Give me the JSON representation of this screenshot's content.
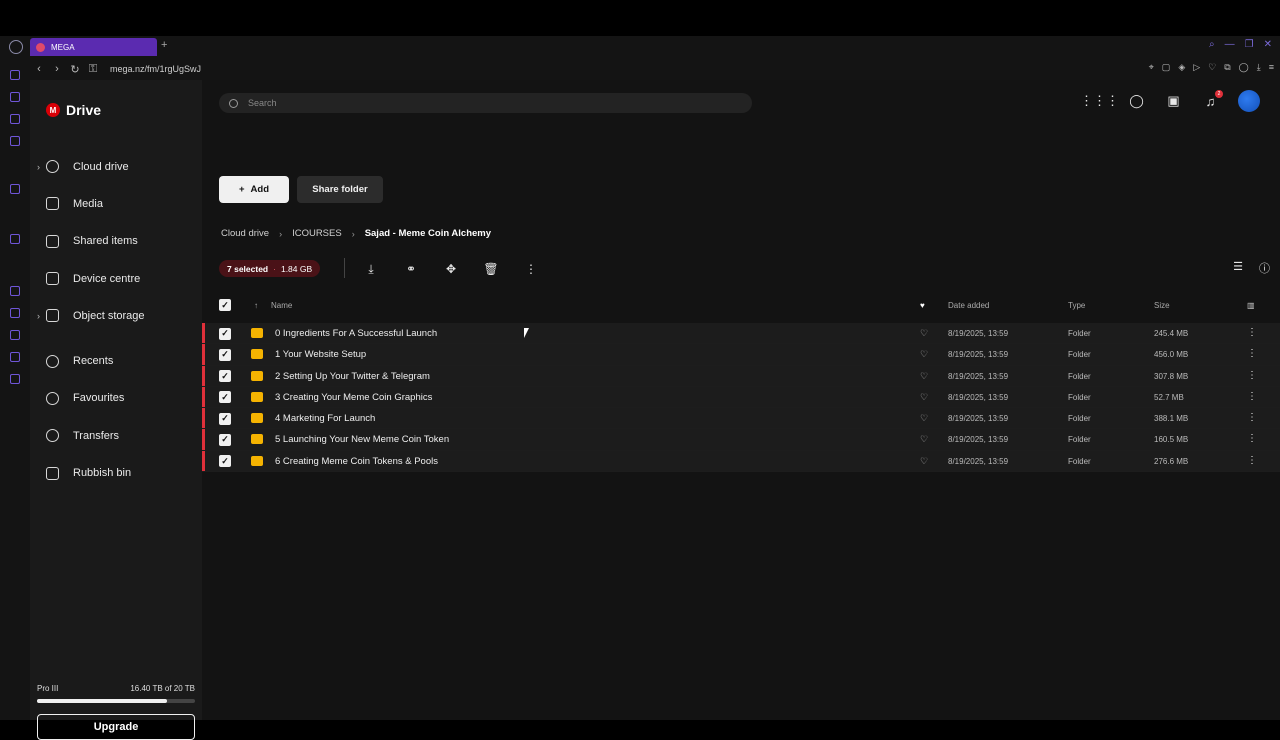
{
  "browser": {
    "tab_title": "MEGA",
    "new_tab_icon": "plus-icon",
    "url": "mega.nz/fm/1rgUgSwJ"
  },
  "app": {
    "logo_letter": "M",
    "logo_text": "Drive",
    "brand_color": "#d90007",
    "accent_color": "#e0303a"
  },
  "sidebar": {
    "items": [
      {
        "label": "Cloud drive",
        "icon": "cloud-icon",
        "expandable": true
      },
      {
        "label": "Media",
        "icon": "image-icon"
      },
      {
        "label": "Shared items",
        "icon": "shared-folder-icon"
      },
      {
        "label": "Device centre",
        "icon": "monitor-icon"
      },
      {
        "label": "Object storage",
        "icon": "bucket-icon",
        "expandable": true
      },
      {
        "label": "Recents",
        "icon": "clock-icon"
      },
      {
        "label": "Favourites",
        "icon": "heart-icon"
      },
      {
        "label": "Transfers",
        "icon": "transfer-icon"
      },
      {
        "label": "Rubbish bin",
        "icon": "trash-icon"
      }
    ],
    "plan": "Pro III",
    "storage_used": "16.40 TB of 20 TB",
    "storage_fraction": 0.82,
    "upgrade_label": "Upgrade"
  },
  "search": {
    "placeholder": "Search"
  },
  "toolbar": {
    "add_label": "Add",
    "share_label": "Share folder"
  },
  "breadcrumb": [
    "Cloud drive",
    "ICOURSES",
    "Sajad - Meme Coin Alchemy"
  ],
  "selection": {
    "count": "7 selected",
    "size": "1.84 GB"
  },
  "table": {
    "headers": {
      "name": "Name",
      "date": "Date added",
      "type": "Type",
      "size": "Size"
    },
    "rows": [
      {
        "name": "0 Ingredients For A Successful Launch",
        "date": "8/19/2025, 13:59",
        "type": "Folder",
        "size": "245.4 MB"
      },
      {
        "name": "1 Your Website Setup",
        "date": "8/19/2025, 13:59",
        "type": "Folder",
        "size": "456.0 MB"
      },
      {
        "name": "2 Setting Up Your Twitter & Telegram",
        "date": "8/19/2025, 13:59",
        "type": "Folder",
        "size": "307.8 MB"
      },
      {
        "name": "3 Creating Your Meme Coin Graphics",
        "date": "8/19/2025, 13:59",
        "type": "Folder",
        "size": "52.7 MB"
      },
      {
        "name": "4 Marketing For Launch",
        "date": "8/19/2025, 13:59",
        "type": "Folder",
        "size": "388.1 MB"
      },
      {
        "name": "5 Launching Your New Meme Coin Token",
        "date": "8/19/2025, 13:59",
        "type": "Folder",
        "size": "160.5 MB"
      },
      {
        "name": "6 Creating Meme Coin Tokens & Pools",
        "date": "8/19/2025, 13:59",
        "type": "Folder",
        "size": "276.6 MB"
      }
    ]
  },
  "notifications_badge": "2"
}
